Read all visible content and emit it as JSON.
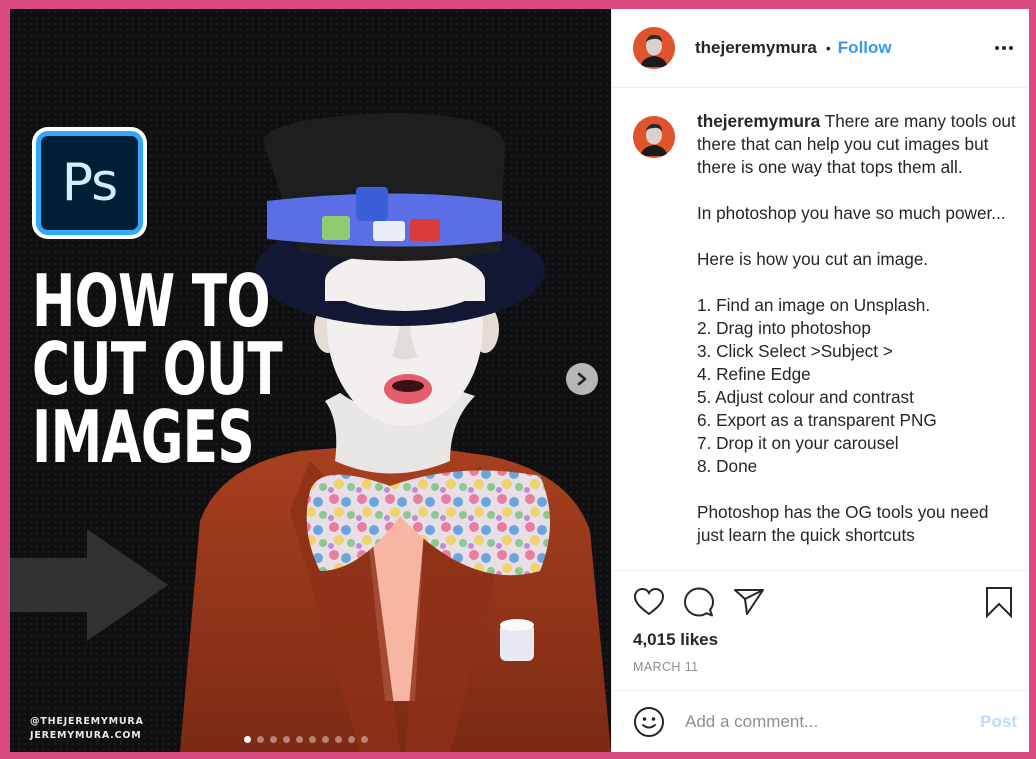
{
  "colors": {
    "frame": "#d84c7f",
    "accent": "#3897f0",
    "post_disabled": "#b9dcfb",
    "muted": "#8e8e8e",
    "text": "#262626",
    "avatar_bg": "#e0542c"
  },
  "media": {
    "app_logo": {
      "icon": "photoshop-logo-icon",
      "text": "Ps"
    },
    "headline": [
      "HOW TO",
      "CUT OUT",
      "IMAGES"
    ],
    "arrow_icon": "right-arrow-graphic",
    "credits": [
      "@THEJEREMYMURA",
      "JEREMYMURA.COM"
    ],
    "next_button_icon": "chevron-right-icon",
    "carousel": {
      "total": 10,
      "active_index": 0
    }
  },
  "header": {
    "username": "thejeremymura",
    "separator": "•",
    "follow_label": "Follow",
    "more_icon": "more-horizontal-icon"
  },
  "caption": {
    "username": "thejeremymura",
    "paragraphs": [
      [
        "There are many tools out there that can help you cut images but there is one way that tops them all."
      ],
      [
        "In photoshop you have so much power..."
      ],
      [
        "Here is how you cut an image."
      ],
      [
        "1. Find an image on Unsplash.",
        "2. Drag into photoshop",
        "3. Click Select >Subject >",
        "4. Refine Edge",
        "5. Adjust colour and contrast",
        "6. Export as a transparent PNG",
        "7. Drop it on your carousel",
        "8. Done"
      ],
      [
        "Photoshop has the OG tools you need just learn the quick shortcuts"
      ]
    ]
  },
  "actions": {
    "like_icon": "heart-icon",
    "comment_icon": "comment-icon",
    "share_icon": "paper-plane-icon",
    "save_icon": "bookmark-icon",
    "likes": "4,015 likes",
    "date": "MARCH 11"
  },
  "comment_box": {
    "emoji_icon": "smiley-icon",
    "placeholder": "Add a comment...",
    "value": "",
    "post_label": "Post"
  }
}
